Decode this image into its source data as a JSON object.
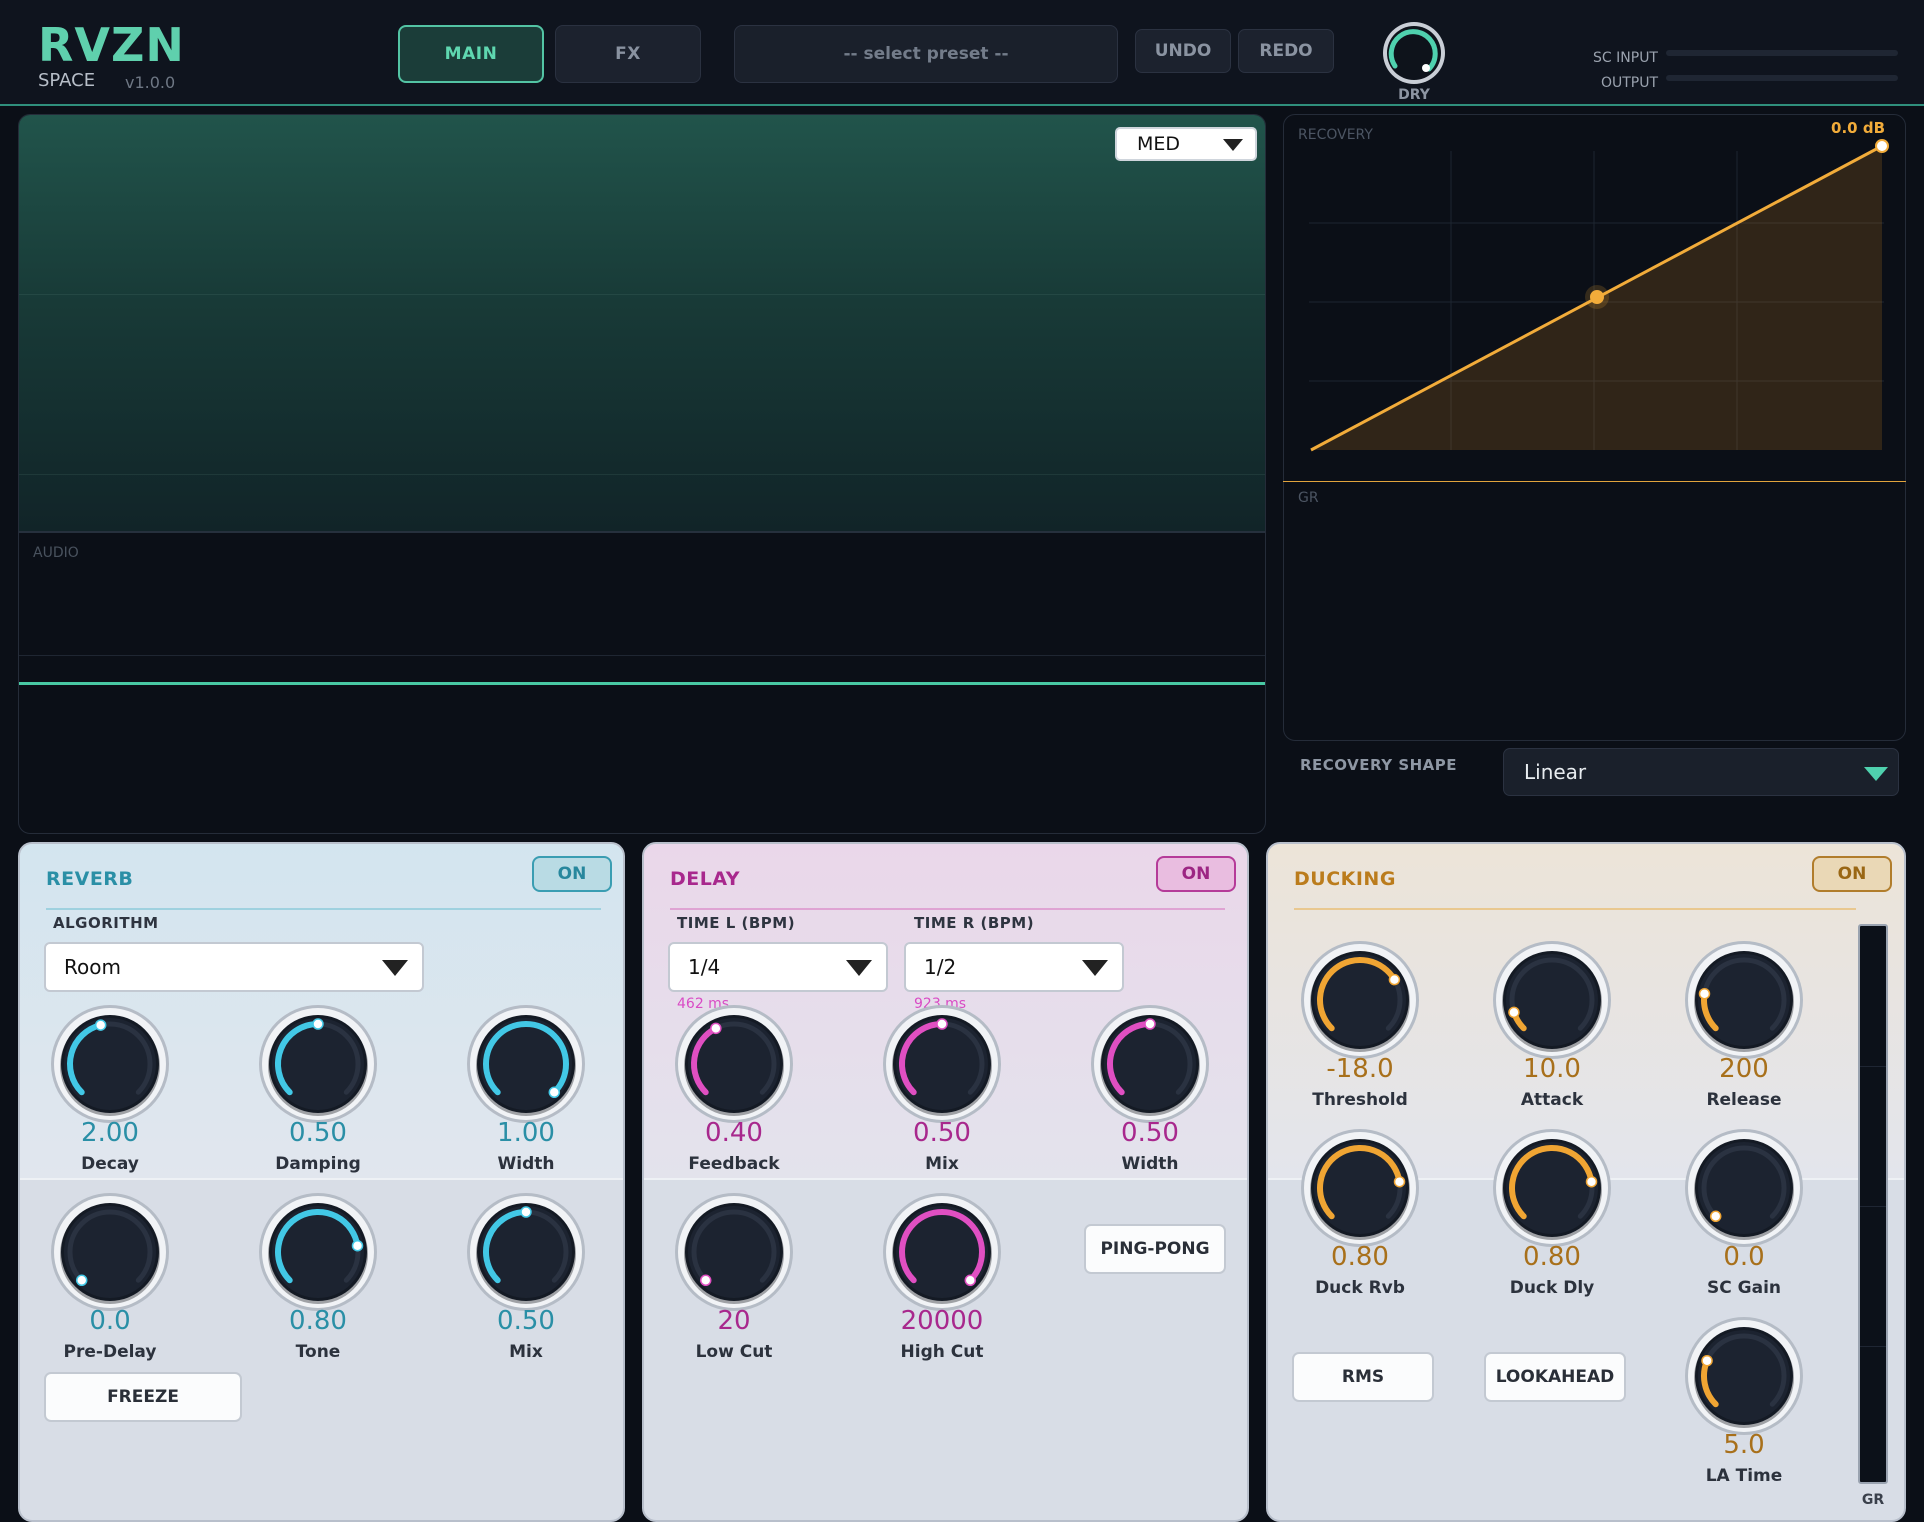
{
  "header": {
    "logo_title": "RVZN",
    "logo_subtitle": "SPACE",
    "version": "v1.0.0",
    "tabs": [
      {
        "label": "MAIN",
        "active": true
      },
      {
        "label": "FX",
        "active": false
      }
    ],
    "preset_placeholder": "-- select preset --",
    "undo_label": "UNDO",
    "redo_label": "REDO",
    "dry_label": "DRY",
    "sc_input_label": "SC INPUT",
    "output_label": "OUTPUT"
  },
  "waveform": {
    "envelope_label": "",
    "resolution_value": "MED",
    "audio_label": "AUDIO"
  },
  "recovery": {
    "label": "RECOVERY",
    "db_readout": "0.0 dB",
    "gr_label": "GR",
    "shape_label": "RECOVERY SHAPE",
    "shape_value": "Linear"
  },
  "reverb": {
    "title": "REVERB",
    "on_label": "ON",
    "algorithm_label": "ALGORITHM",
    "algorithm_value": "Room",
    "knobs": [
      {
        "value": "2.00",
        "label": "Decay",
        "norm": 0.45
      },
      {
        "value": "0.50",
        "label": "Damping",
        "norm": 0.5
      },
      {
        "value": "1.00",
        "label": "Width",
        "norm": 1.0
      },
      {
        "value": "0.0",
        "label": "Pre-Delay",
        "norm": 0.0
      },
      {
        "value": "0.80",
        "label": "Tone",
        "norm": 0.8
      },
      {
        "value": "0.50",
        "label": "Mix",
        "norm": 0.5
      }
    ],
    "freeze_label": "FREEZE"
  },
  "delay": {
    "title": "DELAY",
    "on_label": "ON",
    "time_l_label": "TIME L (BPM)",
    "time_l_value": "1/4",
    "time_l_ms": "462 ms",
    "time_r_label": "TIME R (BPM)",
    "time_r_value": "1/2",
    "time_r_ms": "923 ms",
    "knobs": [
      {
        "value": "0.40",
        "label": "Feedback",
        "norm": 0.4
      },
      {
        "value": "0.50",
        "label": "Mix",
        "norm": 0.5
      },
      {
        "value": "0.50",
        "label": "Width",
        "norm": 0.5
      },
      {
        "value": "20",
        "label": "Low Cut",
        "norm": 0.0
      },
      {
        "value": "20000",
        "label": "High Cut",
        "norm": 1.0
      }
    ],
    "ping_pong_label": "PING-PONG"
  },
  "ducking": {
    "title": "DUCKING",
    "on_label": "ON",
    "knobs": [
      {
        "value": "-18.0",
        "label": "Threshold",
        "norm": 0.72
      },
      {
        "value": "10.0",
        "label": "Attack",
        "norm": 0.1
      },
      {
        "value": "200",
        "label": "Release",
        "norm": 0.2
      },
      {
        "value": "0.80",
        "label": "Duck Rvb",
        "norm": 0.8
      },
      {
        "value": "0.80",
        "label": "Duck Dly",
        "norm": 0.8
      },
      {
        "value": "0.0",
        "label": "SC Gain",
        "norm": 0.0
      },
      {
        "value": "5.0",
        "label": "LA Time",
        "norm": 0.25
      }
    ],
    "rms_label": "RMS",
    "lookahead_label": "LOOKAHEAD",
    "gr_label": "GR"
  },
  "colors": {
    "accent_teal": "#5fd0ad",
    "reverb": "#42c8e6",
    "delay": "#e04fc2",
    "ducking": "#f0a533"
  }
}
